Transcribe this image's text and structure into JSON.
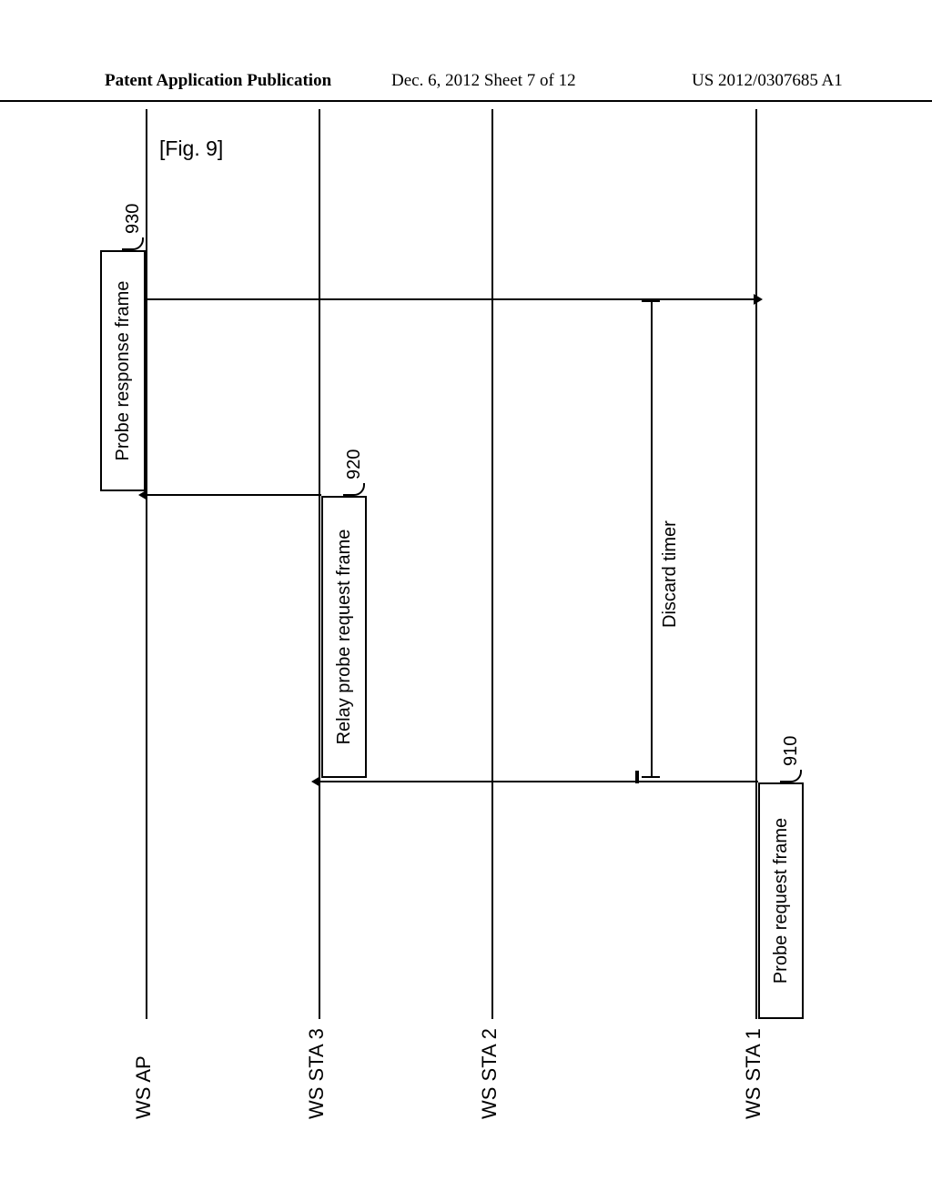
{
  "header": {
    "left": "Patent Application Publication",
    "center": "Dec. 6, 2012  Sheet 7 of 12",
    "right": "US 2012/0307685 A1"
  },
  "figure_label": "[Fig. 9]",
  "lanes": {
    "ap": "WS AP",
    "sta3": "WS STA 3",
    "sta2": "WS STA 2",
    "sta1": "WS STA 1"
  },
  "boxes": {
    "probe_request": "Probe request frame",
    "relay_probe": "Relay probe request frame",
    "probe_response": "Probe response frame"
  },
  "labels": {
    "discard_timer": "Discard timer"
  },
  "refs": {
    "r910": "910",
    "r920": "920",
    "r930": "930"
  }
}
